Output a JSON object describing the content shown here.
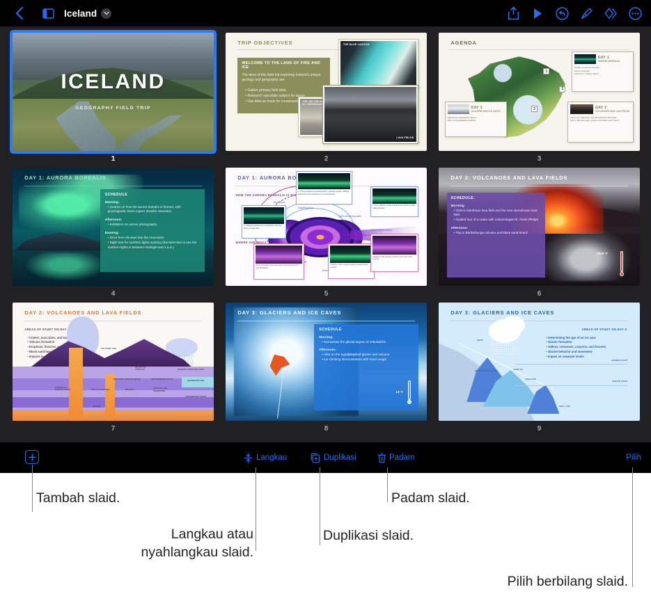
{
  "app": {
    "document_title": "Iceland",
    "background_color": "#212123",
    "accent_color": "#2a6cf0",
    "selection_color": "#2a7bf5"
  },
  "topbar": {
    "back_icon": "chevron-left-icon",
    "sidebar_icon": "sidebar-panel-icon",
    "title_chevron_icon": "chevron-down-icon",
    "actions": [
      {
        "name": "share-icon",
        "label": "Share"
      },
      {
        "name": "play-icon",
        "label": "Play"
      },
      {
        "name": "undo-icon",
        "label": "Undo"
      },
      {
        "name": "brush-icon",
        "label": "Format"
      },
      {
        "name": "animate-icon",
        "label": "Animate"
      },
      {
        "name": "more-icon",
        "label": "More"
      }
    ]
  },
  "bottombar": {
    "add_label": "+",
    "skip_label": "Langkau",
    "duplicate_label": "Duplikasi",
    "delete_label": "Padam",
    "select_label": "Pilih",
    "skip_icon": "skip-slide-icon",
    "duplicate_icon": "duplicate-icon",
    "delete_icon": "trash-icon"
  },
  "callouts": [
    {
      "id": "add",
      "text": "Tambah slaid."
    },
    {
      "id": "skip",
      "text": "Langkau atau\nnyahlangkau slaid."
    },
    {
      "id": "duplicate",
      "text": "Duplikasi slaid."
    },
    {
      "id": "delete",
      "text": "Padam slaid."
    },
    {
      "id": "select",
      "text": "Pilih berbilang slaid."
    }
  ],
  "slides": [
    {
      "number": "1",
      "selected": true,
      "title": "ICELAND",
      "subtitle": "GEOGRAPHY FIELD TRIP"
    },
    {
      "number": "2",
      "selected": false,
      "title": "TRIP OBJECTIVES",
      "box_heading": "WELCOME TO THE LAND OF FIRE AND ICE",
      "box_text": "The aims of this field trip exploring Iceland's unique geology and geography are:",
      "bullets": [
        "Gather primary field data",
        "Research specialist subject for essay",
        "Use data as basis for coursework"
      ],
      "photo_captions": [
        "THE BLUE LAGOON",
        "THE GEYSIR AND SMELLY SPRINGS AT HVERIR/NAMAFJALL",
        "LAVA FIELDS"
      ]
    },
    {
      "number": "3",
      "selected": false,
      "title": "AGENDA",
      "pins": [
        "1",
        "2",
        "3"
      ],
      "cards": [
        {
          "day": "DAY 1",
          "sub": "AURORA BOREALIS",
          "bullets": [
            "Lecture on aurora borealis",
            "Aurora viewings",
            "Viewing of northern lights"
          ]
        },
        {
          "day": "DAY 2",
          "sub": "VOLCANOES AND LAVA FIELDS",
          "bullets": [
            "Trip to the Holuhraun and Nornahraun lava fields",
            "Visit to Bárðarbunga volcano and black sand beach"
          ]
        },
        {
          "day": "DAY 3",
          "sub": "GLACIERS AND ICE CAVES",
          "bullets": [
            "Sail across Jökulsárlón lagoon",
            "Hike on Eyjafjallajökull glacier"
          ]
        }
      ]
    },
    {
      "number": "4",
      "selected": false,
      "title": "DAY 1: AURORA BOREALIS",
      "schedule_heading": "SCHEDULE",
      "sections": [
        {
          "label": "Morning:",
          "items": [
            "Lecture on how the aurora borealis is formed, with geomagnetic storm expert Jennifer Sorensen"
          ]
        },
        {
          "label": "Afternoon:",
          "items": [
            "Exhibition on aurora photography"
          ]
        },
        {
          "label": "Evening:",
          "items": [
            "Drive from Akureyri into the mountains",
            "Night tour for northern lights spotting (the best time to see the northern lights is between midnight and 2 a.m.)"
          ]
        }
      ]
    },
    {
      "number": "5",
      "selected": false,
      "title": "DAY 1: AURORA BOREALIS",
      "heading_1": "HOW THE AURORA BOREALIS IS FORMED:",
      "heading_2": "WHERE AND WHAT TO LOOK FOR",
      "handwritten": [
        "Bow shock",
        "Magnetopause",
        "Magnetic field lines",
        "Open-closed boundary",
        "Neutral sheet current",
        "Radiation belts and ring current",
        "Plasma sheet",
        "Auroral oval",
        "Lobe"
      ],
      "notes": [
        "1. Charged particles are emitted from the sun during a solar flare",
        "2. These particles penetrate Earth's magnetic shield, colliding with atoms and molecules in our atmosphere",
        "3. The collisions create capsiless tiny bursts of light called photons",
        "Aurora borealis most commonly occurs between 60 and 75 latitude",
        "Collisions with oxygen produce red and green auroras",
        "Collisions with nitrogen produce pink and purple auroras"
      ]
    },
    {
      "number": "6",
      "selected": false,
      "title": "DAY 2: VOLCANOES AND LAVA FIELDS",
      "schedule_heading": "SCHEDULE:",
      "temperature": "2010° F",
      "sections": [
        {
          "label": "Morning:",
          "items": [
            "Visit to Holuhraun lava field and the new Nornahraun lava field",
            "Guided tour of a crater with volcanologist Dr. Grant Phelps"
          ]
        },
        {
          "label": "Afternoon:",
          "items": [
            "Trip to Bárðarbunga volcano and black sand beach"
          ]
        }
      ]
    },
    {
      "number": "7",
      "selected": false,
      "title": "DAY 2: VOLCANOES AND LAVA FIELDS",
      "subheading": "AREAS OF STUDY ON DAY 2:",
      "bullets": [
        "Craters, lava tubes, and lava fields",
        "Volcano formation",
        "Eruptions, fissures, and structure",
        "Black sand beach formation",
        "Impacts lava fields and volcanoes have on the land"
      ],
      "diagram_labels": [
        "VOLCANIC ASH",
        "LAVA",
        "UPLIFT TO SURFACE",
        "EROSION FROM WEATHER",
        "INTRUSIVE IGNEOUS ROCK",
        "METAMORPHIC ROCK",
        "SEDIMENTATION",
        "EXTRUSIVE IGNEOUS ROCK",
        "CRYSTALLIZATION",
        "MELTING",
        "HEATING AND SQUEEZING",
        "SEDIMENTARY ROCK",
        "MAGMA"
      ]
    },
    {
      "number": "8",
      "selected": false,
      "title": "DAY 3: GLACIERS AND ICE CAVES",
      "schedule_heading": "SCHEDULE",
      "temperature": "14° F",
      "sections": [
        {
          "label": "Morning:",
          "items": [
            "Sail across the glacial lagoon of Jökulsárlón"
          ]
        },
        {
          "label": "Afternoon:",
          "items": [
            "Hike on the Eyjafjallajökull glacier and volcano",
            "Ice climbing demonstration with Kevin Angel"
          ]
        }
      ]
    },
    {
      "number": "9",
      "selected": false,
      "title": "DAY 3: GLACIERS AND ICE CAVES",
      "subheading": "AREAS OF STUDY ON DAY 3:",
      "bullets": [
        "Determining the age of an ice cave",
        "Glacier formation",
        "Valleys, crevasses, canyons, and fissures",
        "Glacier behavior and movement",
        "Impact on seawater levels"
      ],
      "diagram_labels": [
        "SNOW",
        "METAMORPHOSED ICE",
        "HARD ICE",
        "CREVASSE",
        "SUMMER FROST",
        "WINTER FROST",
        "MELT LINE"
      ]
    }
  ]
}
